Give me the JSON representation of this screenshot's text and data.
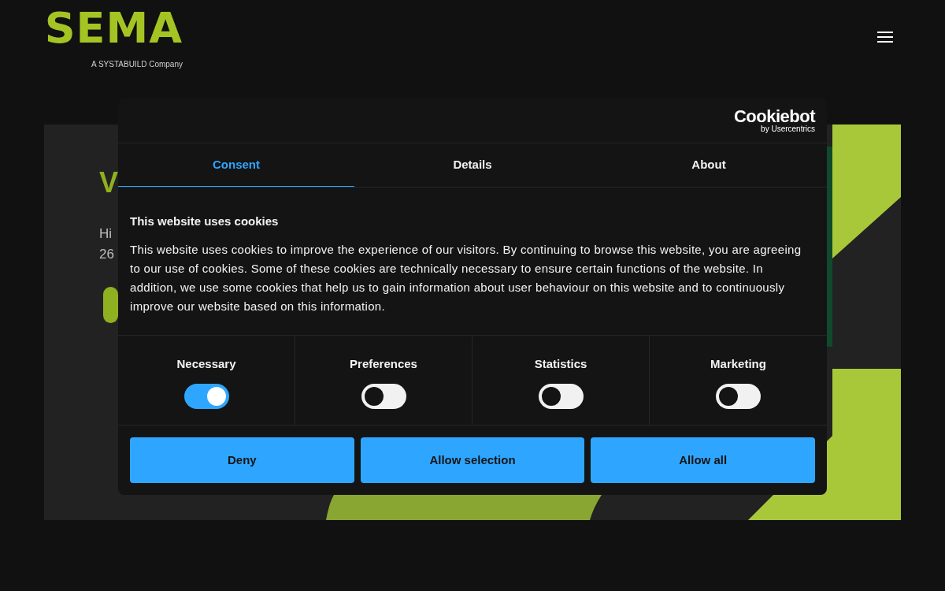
{
  "header": {
    "logo": "SEMA",
    "logo_tagline": "A SYSTABUILD Company"
  },
  "hero": {
    "heading": "V",
    "lines": [
      "Hi",
      "26"
    ]
  },
  "cookie_dialog": {
    "brand": "Cookiebot",
    "brand_sub": "by Usercentrics",
    "tabs": [
      {
        "label": "Consent",
        "selected": true
      },
      {
        "label": "Details",
        "selected": false
      },
      {
        "label": "About",
        "selected": false
      }
    ],
    "title": "This website uses cookies",
    "body": "This website uses cookies to improve the experience of our visitors. By continuing to browse this website, you are agreeing to our use of cookies. Some of these cookies are technically necessary to ensure certain functions of the website. In addition, we use some cookies that help us to gain information about user behaviour on this website and to continuously improve our website based on this information.",
    "categories": [
      {
        "label": "Necessary",
        "on": true
      },
      {
        "label": "Preferences",
        "on": false
      },
      {
        "label": "Statistics",
        "on": false
      },
      {
        "label": "Marketing",
        "on": false
      }
    ],
    "buttons": [
      "Deny",
      "Allow selection",
      "Allow all"
    ]
  }
}
